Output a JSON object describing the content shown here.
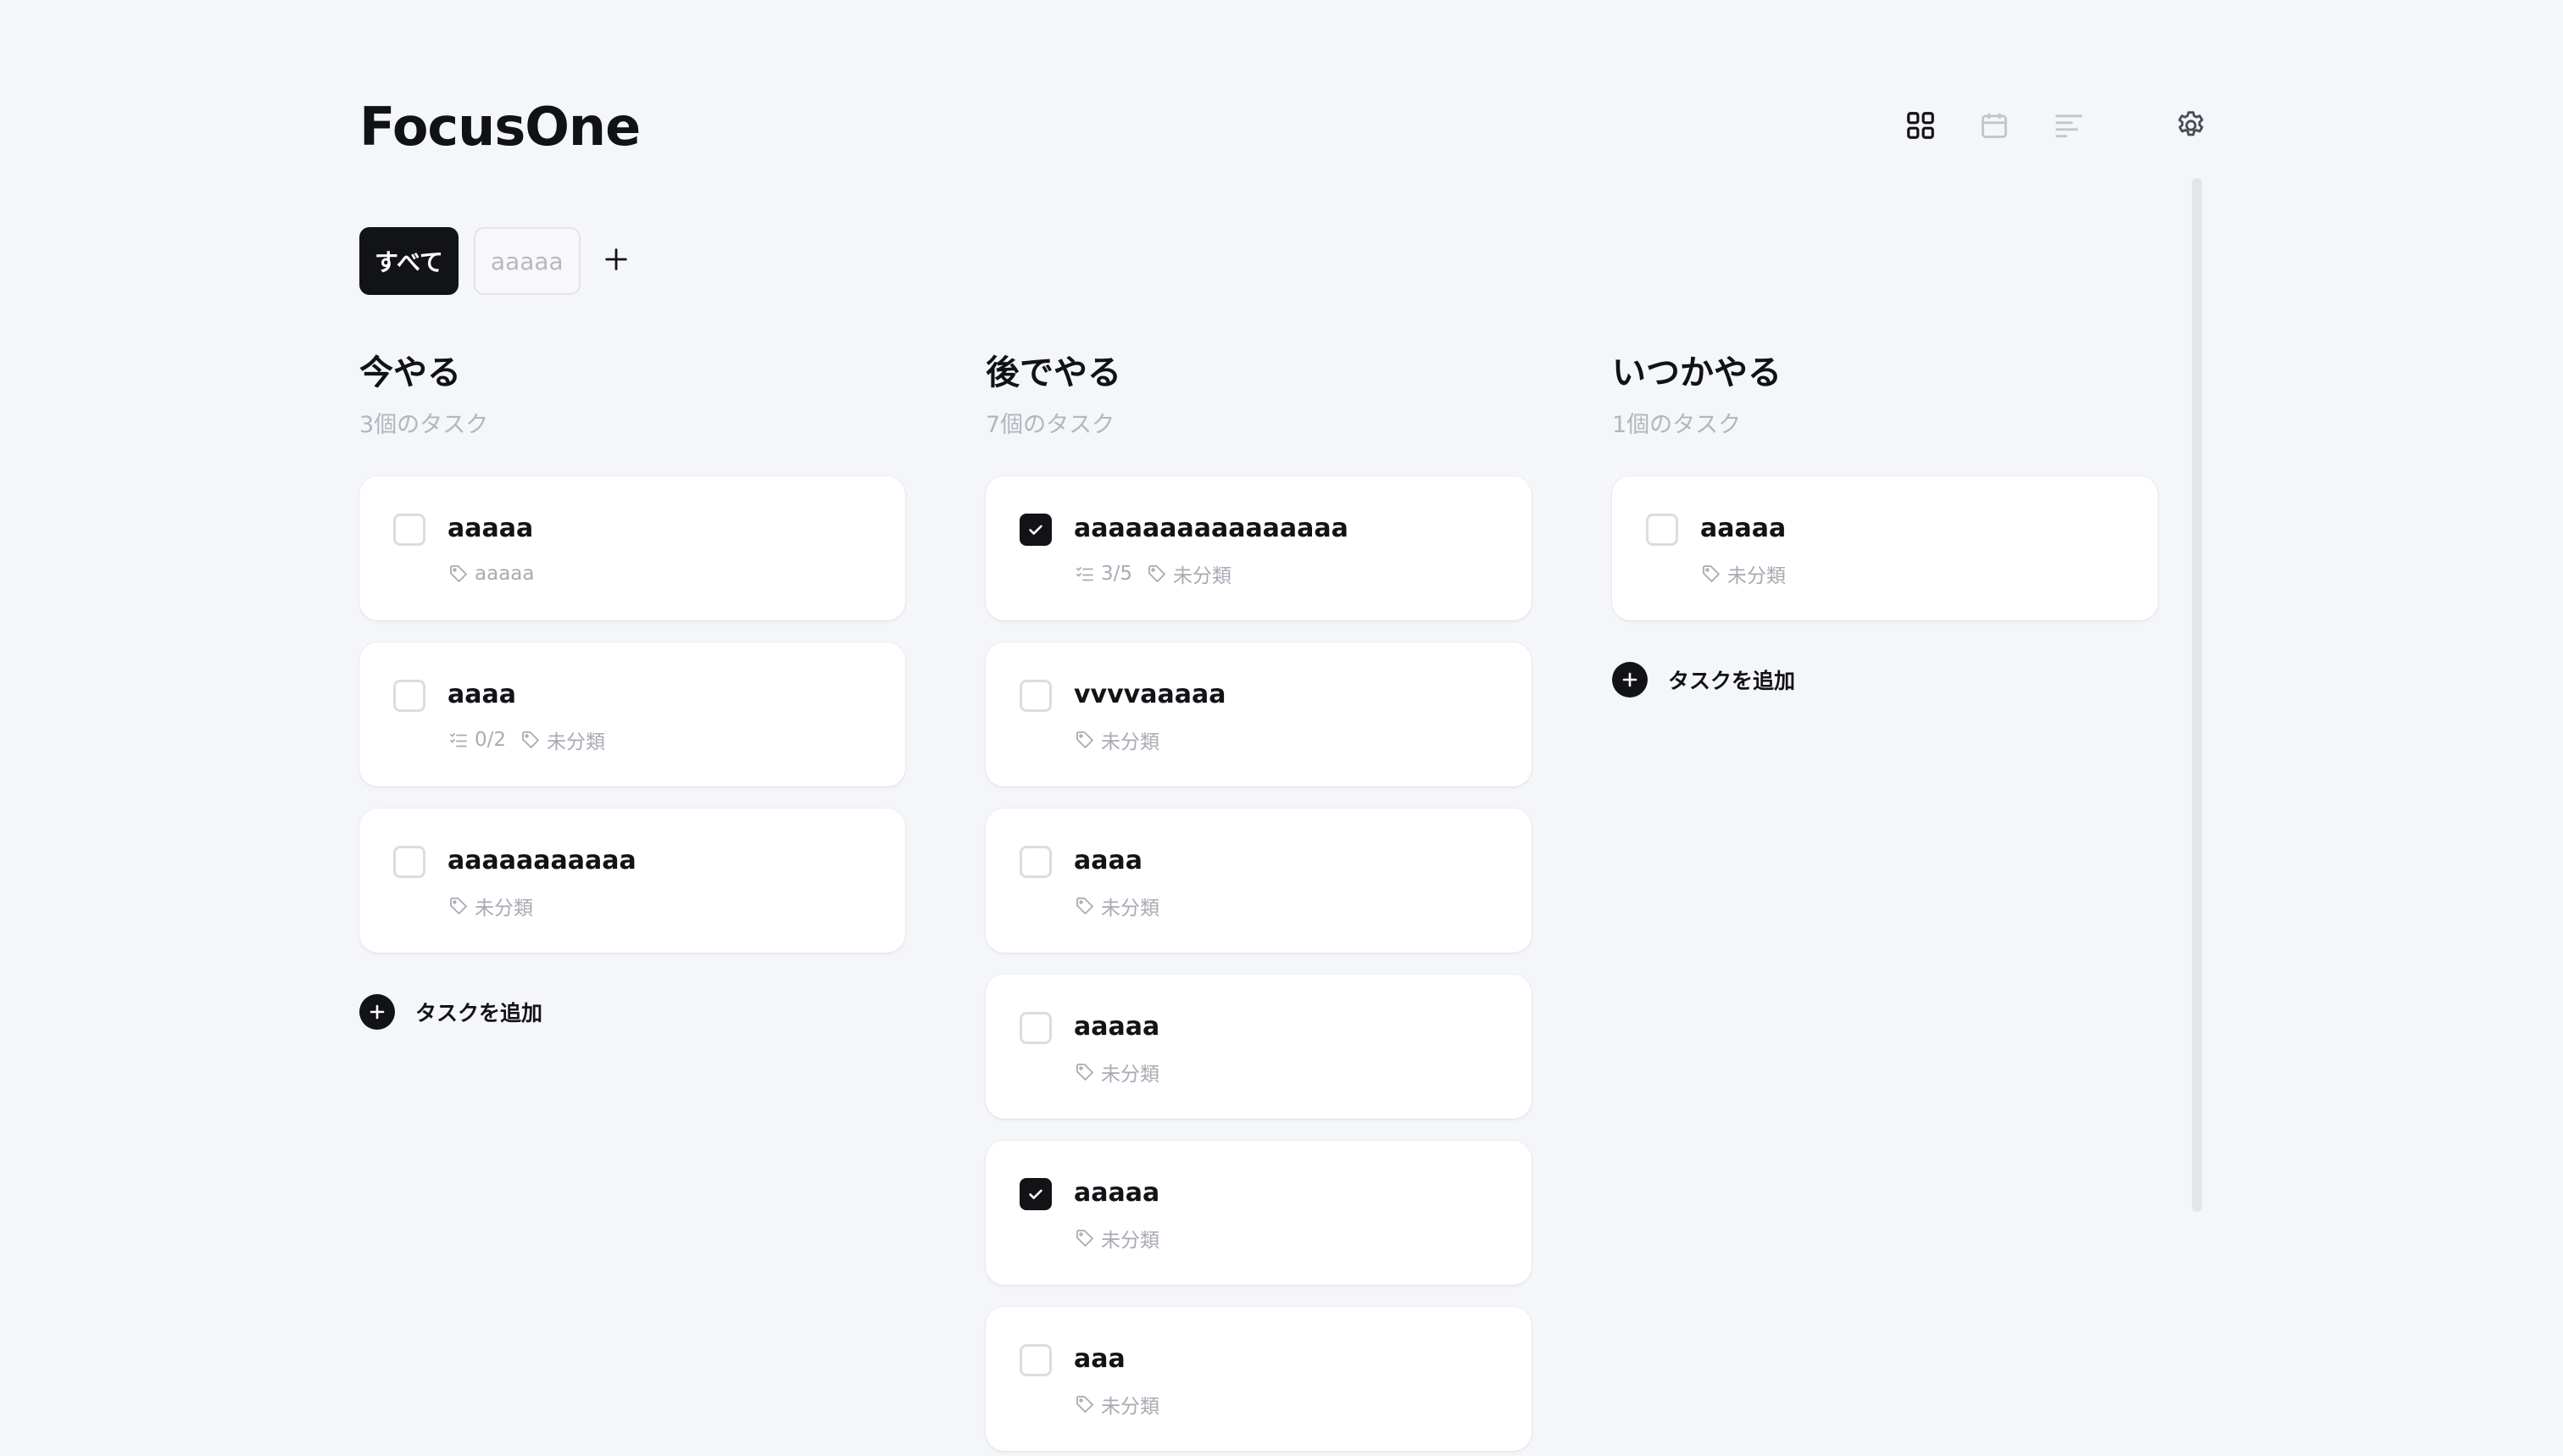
{
  "app": {
    "title": "FocusOne"
  },
  "toolbar": {
    "items": [
      {
        "name": "grid-view",
        "icon": "grid-icon",
        "active": true
      },
      {
        "name": "calendar-view",
        "icon": "calendar-icon",
        "active": false
      },
      {
        "name": "timeline-view",
        "icon": "timeline-icon",
        "active": false
      },
      {
        "name": "settings",
        "icon": "gear-icon",
        "active": false
      }
    ]
  },
  "tabs": {
    "items": [
      {
        "label": "すべて",
        "active": true
      },
      {
        "label": "aaaaa",
        "active": false
      }
    ],
    "add_icon": "plus-icon"
  },
  "columns": [
    {
      "title": "今やる",
      "count_label": "3個のタスク",
      "add_label": "タスクを追加",
      "tasks": [
        {
          "title": "aaaaa",
          "checked": false,
          "subtasks": "",
          "tag": "aaaaa"
        },
        {
          "title": "aaaa",
          "checked": false,
          "subtasks": "0/2",
          "tag": "未分類"
        },
        {
          "title": "aaaaaaaaaaa",
          "checked": false,
          "subtasks": "",
          "tag": "未分類"
        }
      ]
    },
    {
      "title": "後でやる",
      "count_label": "7個のタスク",
      "add_label": "",
      "tasks": [
        {
          "title": "aaaaaaaaaaaaaaaa",
          "checked": true,
          "subtasks": "3/5",
          "tag": "未分類"
        },
        {
          "title": "vvvvaaaaa",
          "checked": false,
          "subtasks": "",
          "tag": "未分類"
        },
        {
          "title": "aaaa",
          "checked": false,
          "subtasks": "",
          "tag": "未分類"
        },
        {
          "title": "aaaaa",
          "checked": false,
          "subtasks": "",
          "tag": "未分類"
        },
        {
          "title": "aaaaa",
          "checked": true,
          "subtasks": "",
          "tag": "未分類"
        },
        {
          "title": "aaa",
          "checked": false,
          "subtasks": "",
          "tag": "未分類"
        }
      ]
    },
    {
      "title": "いつかやる",
      "count_label": "1個のタスク",
      "add_label": "タスクを追加",
      "tasks": [
        {
          "title": "aaaaa",
          "checked": false,
          "subtasks": "",
          "tag": "未分類"
        }
      ]
    }
  ],
  "colors": {
    "background": "#f5f6fa",
    "primary": "#121317",
    "muted": "#b3b6bd",
    "border": "#dcdde2"
  }
}
